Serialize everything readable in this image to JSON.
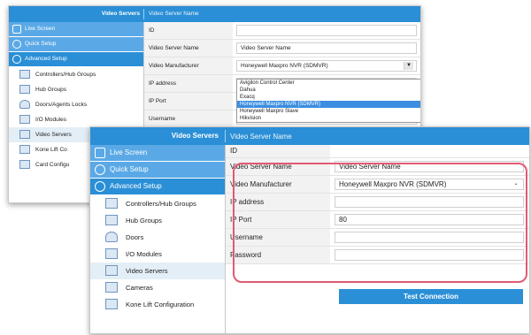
{
  "colors": {
    "accent": "#2a8fd6",
    "highlight": "#e25a74",
    "nav_section": "#5aa9e6"
  },
  "back_panel": {
    "section_title": "Video Servers",
    "video_server_name": "Video Server Name",
    "nav_sections": [
      {
        "label": "Live Screen",
        "icon": "screen-icon"
      },
      {
        "label": "Quick Setup",
        "icon": "gear-icon"
      },
      {
        "label": "Advanced Setup",
        "icon": "network-icon"
      }
    ],
    "nav_items": [
      {
        "label": "Controllers/Hub Groups",
        "icon": "controller-icon"
      },
      {
        "label": "Hub Groups",
        "icon": "hub-icon"
      },
      {
        "label": "Doors/Agents Locks",
        "icon": "door-icon"
      },
      {
        "label": "I/O Modules",
        "icon": "io-icon"
      },
      {
        "label": "Video Servers",
        "icon": "video-server-icon"
      },
      {
        "label": "Kone Lift Co",
        "icon": "lift-icon"
      },
      {
        "label": "Card Configu",
        "icon": "card-icon"
      }
    ],
    "form": {
      "id_label": "ID",
      "name_label": "Video Server Name",
      "name_value": "Video Server Name",
      "manufacturer_label": "Video Manufacturer",
      "manufacturer_value": "Honeywell Maxpro NVR (SDMVR)",
      "ip_label": "IP address",
      "port_label": "IP Port",
      "username_label": "Username"
    },
    "dropdown_options": [
      "Avigilon Control Center",
      "Dahua",
      "Exacq",
      "Honeywell Maxpro NVR (SDMVR)",
      "Honeywell Maxpro Slave",
      "Hikvision"
    ],
    "dropdown_selected": 3
  },
  "front_panel": {
    "section_title": "Video Servers",
    "video_server_name": "Video Server Name",
    "nav_sections": [
      {
        "label": "Live Screen",
        "icon": "screen-icon"
      },
      {
        "label": "Quick Setup",
        "icon": "gear-icon"
      },
      {
        "label": "Advanced Setup",
        "icon": "network-icon"
      }
    ],
    "nav_items": [
      {
        "label": "Controllers/Hub Groups",
        "icon": "controller-icon"
      },
      {
        "label": "Hub Groups",
        "icon": "hub-icon"
      },
      {
        "label": "Doors",
        "icon": "door-icon"
      },
      {
        "label": "I/O Modules",
        "icon": "io-icon"
      },
      {
        "label": "Video Servers",
        "icon": "video-server-icon"
      },
      {
        "label": "Cameras",
        "icon": "camera-icon"
      },
      {
        "label": "Kone Lift Configuration",
        "icon": "lift-icon"
      }
    ],
    "form": {
      "id_label": "ID",
      "name_label": "Video Server Name",
      "name_value": "Video Server Name",
      "manufacturer_label": "Video Manufacturer",
      "manufacturer_value": "Honeywell Maxpro NVR (SDMVR)",
      "ip_label": "IP address",
      "ip_value": "",
      "port_label": "IP Port",
      "port_value": "80",
      "username_label": "Username",
      "username_value": "",
      "password_label": "Password",
      "password_value": ""
    },
    "test_button": "Test Connection"
  }
}
